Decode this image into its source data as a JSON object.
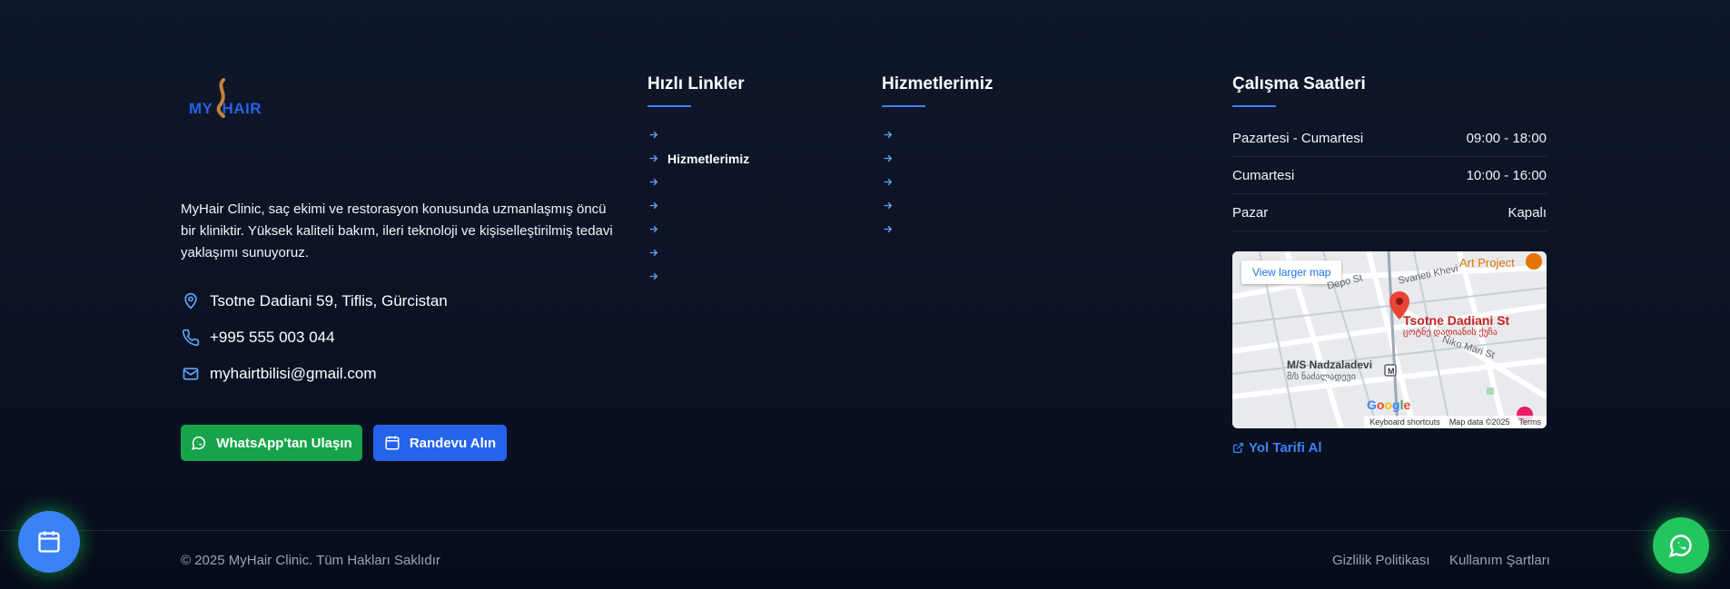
{
  "brand": {
    "logo_text_left": "MY",
    "logo_text_right": "HAIR",
    "about": "MyHair Clinic, saç ekimi ve restorasyon konusunda uzmanlaşmış öncü bir kliniktir. Yüksek kaliteli bakım, ileri teknoloji ve kişiselleştirilmiş tedavi yaklaşımı sunuyoruz."
  },
  "contact": {
    "address": "Tsotne Dadiani 59, Tiflis, Gürcistan",
    "phone": "+995 555 003 044",
    "email": "myhairtbilisi@gmail.com",
    "address_icon": "map-pin-icon",
    "phone_icon": "phone-icon",
    "email_icon": "mail-icon"
  },
  "buttons": {
    "whatsapp": "WhatsApp'tan Ulaşın",
    "appointment": "Randevu Alın"
  },
  "quick_links": {
    "title": "Hızlı Linkler",
    "items": [
      "",
      "Hizmetlerimiz",
      "",
      "",
      "",
      "",
      ""
    ]
  },
  "services": {
    "title": "Hizmetlerimiz",
    "items": [
      "",
      "",
      "",
      "",
      ""
    ]
  },
  "hours": {
    "title": "Çalışma Saatleri",
    "rows": [
      {
        "day": "Pazartesi - Cumartesi",
        "time": "09:00 - 18:00"
      },
      {
        "day": "Cumartesi",
        "time": "10:00 - 16:00"
      },
      {
        "day": "Pazar",
        "time": "Kapalı"
      }
    ]
  },
  "map": {
    "view_larger": "View larger map",
    "place_name": "Tsotne Dadiani St",
    "place_name_local": "ცოტნე დადიანის ქუჩა",
    "metro": "M/S Nadzaladevi",
    "metro_local": "მ/ს ნაძალადევი",
    "art_project": "Art Project",
    "street_1": "Svaneti Khevi",
    "street_2": "Niko Mari St",
    "street_3": "Depo St",
    "google": "Google",
    "attr_keyboard": "Keyboard shortcuts",
    "attr_data": "Map data ©2025",
    "attr_terms": "Terms"
  },
  "directions": "Yol Tarifi Al",
  "footer": {
    "copyright": "© 2025 MyHair Clinic. Tüm Hakları Saklıdır",
    "privacy": "Gizlilik Politikası",
    "terms": "Kullanım Şartları"
  },
  "colors": {
    "accent": "#3b82f6",
    "whatsapp": "#16a34a",
    "appointment": "#2563eb",
    "background": "#0f172a"
  }
}
